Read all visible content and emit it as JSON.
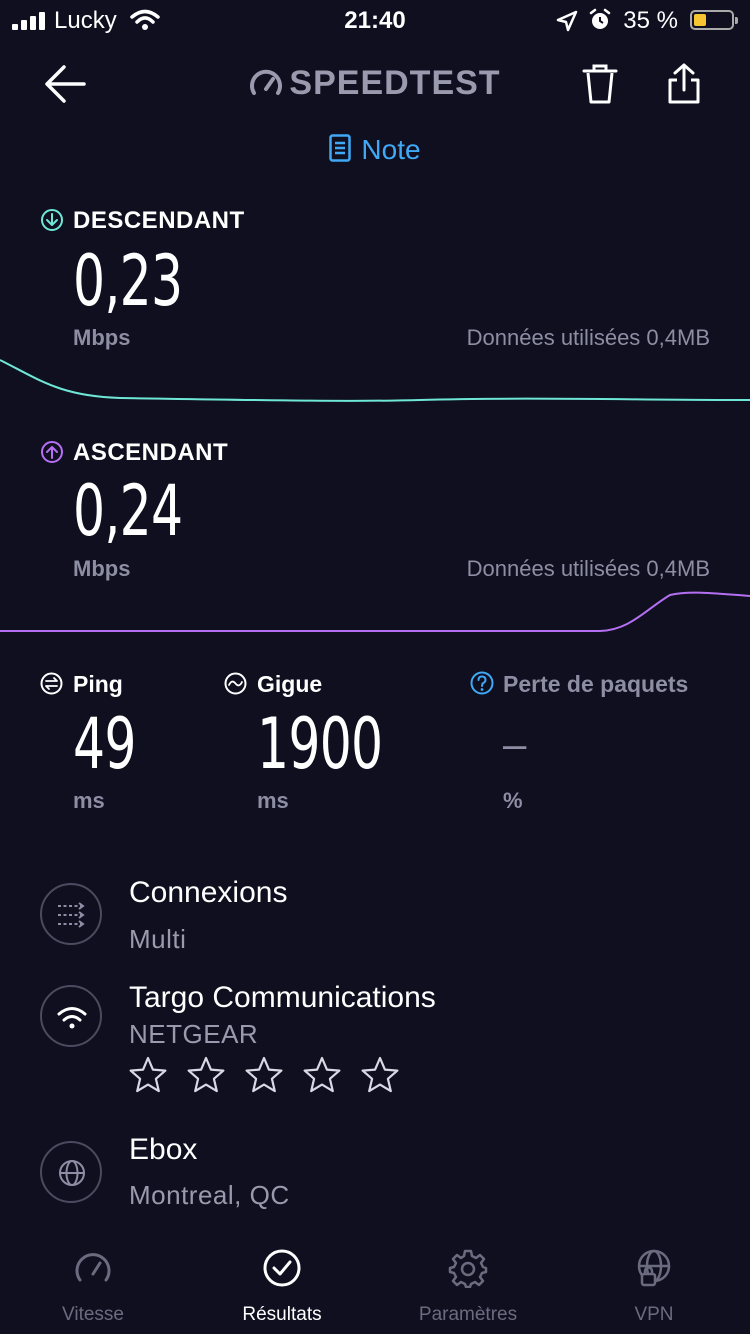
{
  "status_bar": {
    "carrier": "Lucky",
    "time": "21:40",
    "battery_percent": "35 %"
  },
  "header": {
    "brand": "SPEEDTEST",
    "note_label": "Note"
  },
  "download": {
    "label": "DESCENDANT",
    "value": "0,23",
    "unit": "Mbps",
    "data_used": "Données utilisées 0,4MB",
    "color": "#6ee7d6"
  },
  "upload": {
    "label": "ASCENDANT",
    "value": "0,24",
    "unit": "Mbps",
    "data_used": "Données utilisées 0,4MB",
    "color": "#b46ff2"
  },
  "metrics": {
    "ping": {
      "label": "Ping",
      "value": "49",
      "unit": "ms"
    },
    "jitter": {
      "label": "Gigue",
      "value": "1900",
      "unit": "ms"
    },
    "packet_loss": {
      "label": "Perte de paquets",
      "value": "–",
      "unit": "%"
    }
  },
  "details": {
    "connections": {
      "title": "Connexions",
      "subtitle": "Multi",
      "icon": "connections-icon"
    },
    "provider": {
      "title": "Targo Communications",
      "subtitle": "NETGEAR",
      "icon": "wifi-icon",
      "rating": 0,
      "rating_max": 5
    },
    "server": {
      "title": "Ebox",
      "subtitle": "Montreal, QC",
      "icon": "globe-icon"
    }
  },
  "tabs": [
    {
      "label": "Vitesse",
      "icon": "speedometer-icon",
      "active": false
    },
    {
      "label": "Résultats",
      "icon": "check-circle-icon",
      "active": true
    },
    {
      "label": "Paramètres",
      "icon": "gear-icon",
      "active": false
    },
    {
      "label": "VPN",
      "icon": "vpn-globe-icon",
      "active": false
    }
  ],
  "colors": {
    "background": "#0f0f1f",
    "accent_blue": "#3fa9f5",
    "muted": "#8d8da4"
  }
}
